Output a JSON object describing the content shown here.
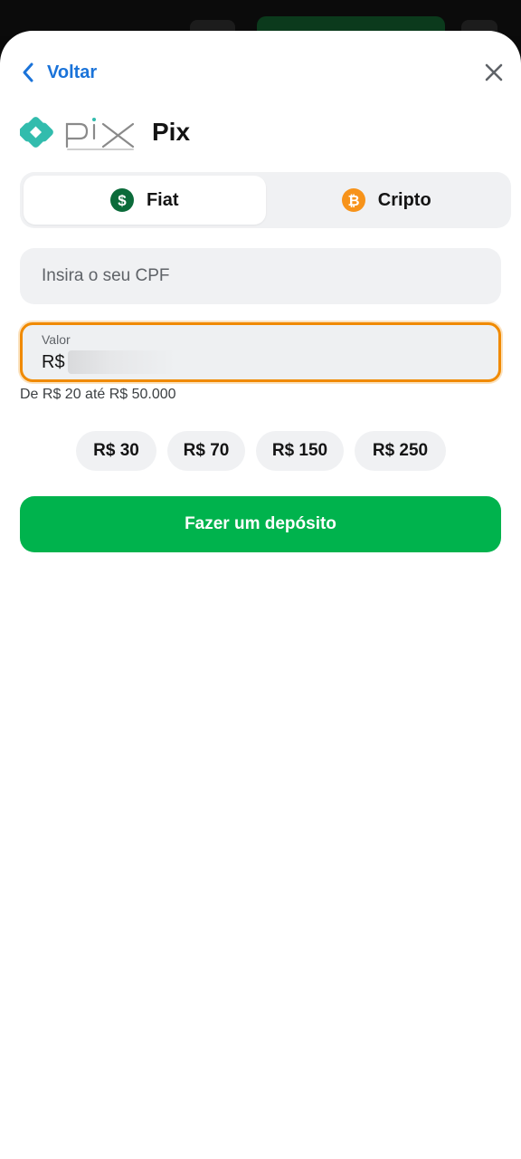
{
  "header": {
    "back_label": "Voltar",
    "title": "Pix"
  },
  "tabs": [
    {
      "label": "Fiat",
      "icon": "dollar-coin-icon",
      "active": true
    },
    {
      "label": "Cripto",
      "icon": "bitcoin-icon",
      "active": false
    }
  ],
  "cpf": {
    "placeholder": "Insira o seu CPF",
    "value": ""
  },
  "amount": {
    "label": "Valor",
    "currency_prefix": "R$",
    "range_hint": "De R$ 20 até R$ 50.000"
  },
  "quick_amounts": [
    "R$ 30",
    "R$ 70",
    "R$ 150",
    "R$ 250"
  ],
  "deposit_button": "Fazer um depósito",
  "colors": {
    "accent_blue": "#1a73d9",
    "deposit_green": "#00b34d",
    "focus_orange": "#f08a00",
    "pix_teal": "#32bcad",
    "bitcoin_orange": "#f7931a",
    "fiat_green": "#0b6b3a"
  }
}
